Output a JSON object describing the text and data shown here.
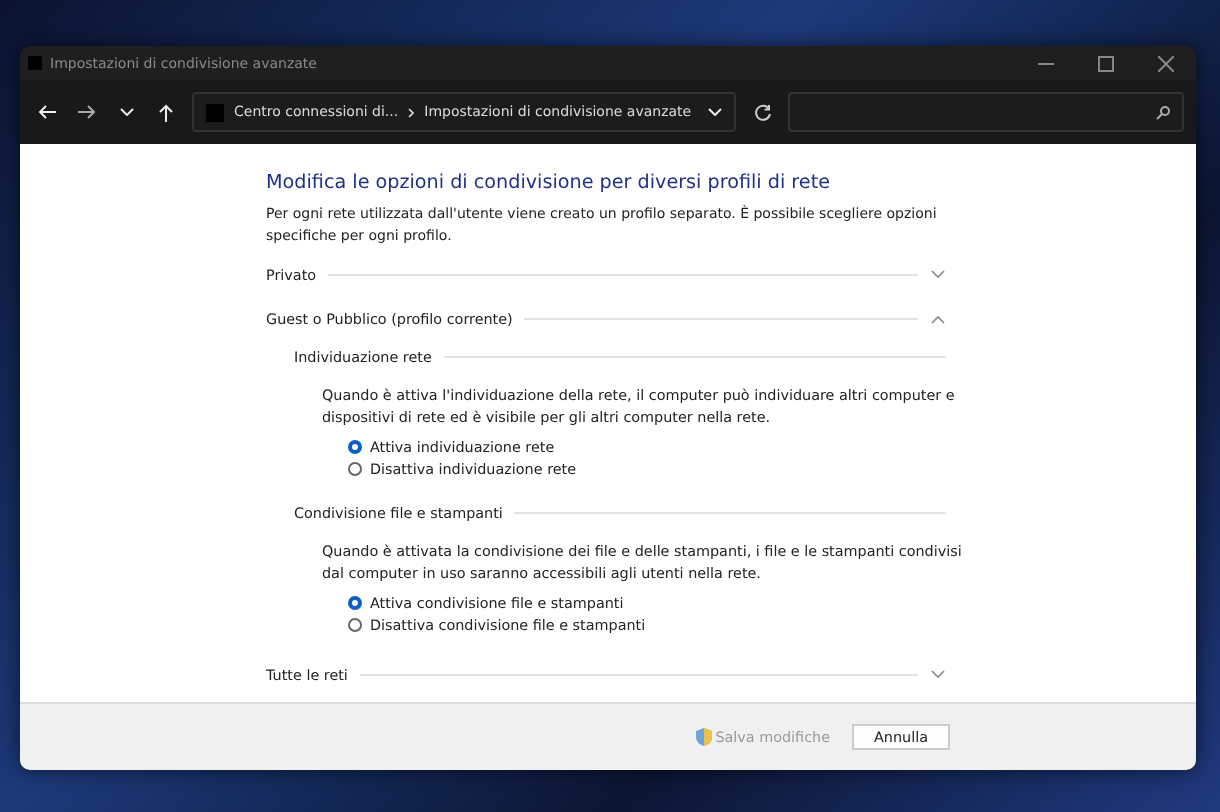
{
  "window": {
    "title": "Impostazioni di condivisione avanzate"
  },
  "address_bar": {
    "breadcrumbs": [
      "Centro connessioni di...",
      "Impostazioni di condivisione avanzate"
    ]
  },
  "content": {
    "heading": "Modifica le opzioni di condivisione per diversi profili di rete",
    "intro": "Per ogni rete utilizzata dall'utente viene creato un profilo separato. È possibile scegliere opzioni specifiche per ogni profilo.",
    "sections": [
      {
        "label": "Privato",
        "expanded": false
      },
      {
        "label": "Guest o Pubblico (profilo corrente)",
        "expanded": true,
        "groups": [
          {
            "title": "Individuazione rete",
            "description": "Quando è attiva l'individuazione della rete, il computer può individuare altri computer e dispositivi di rete ed è visibile per gli altri computer nella rete.",
            "options": [
              {
                "label": "Attiva individuazione rete",
                "selected": true
              },
              {
                "label": "Disattiva individuazione rete",
                "selected": false
              }
            ]
          },
          {
            "title": "Condivisione file e stampanti",
            "description": "Quando è attivata la condivisione dei file e delle stampanti, i file e le stampanti condivisi dal computer in uso saranno accessibili agli utenti nella rete.",
            "options": [
              {
                "label": "Attiva condivisione file e stampanti",
                "selected": true
              },
              {
                "label": "Disattiva condivisione file e stampanti",
                "selected": false
              }
            ]
          }
        ]
      },
      {
        "label": "Tutte le reti",
        "expanded": false
      }
    ]
  },
  "footer": {
    "buttons": [
      {
        "label": "Salva modifiche",
        "kind": "shield",
        "disabled": true
      },
      {
        "label": "Annulla",
        "kind": "plain",
        "disabled": false
      }
    ]
  }
}
